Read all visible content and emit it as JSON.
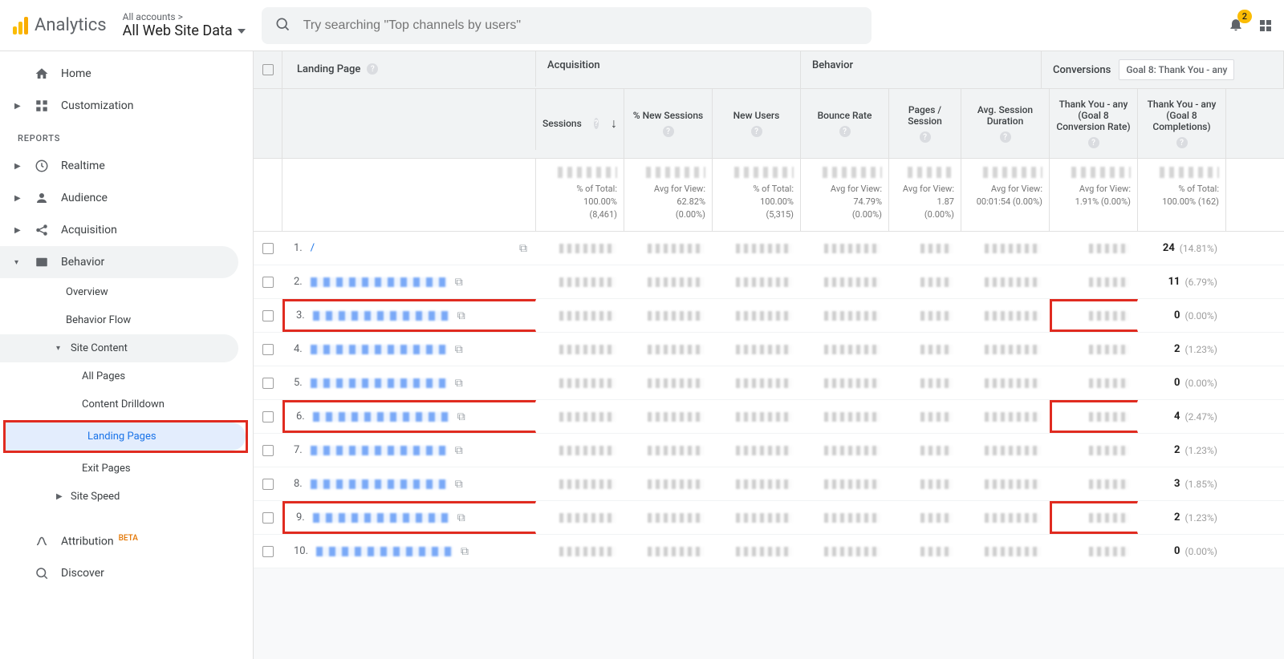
{
  "header": {
    "brand": "Analytics",
    "breadcrumb_label": "All accounts >",
    "view_name": "All Web Site Data",
    "search_placeholder": "Try searching \"Top channels by users\"",
    "notification_count": "2"
  },
  "sidebar": {
    "home": "Home",
    "customization": "Customization",
    "reports_header": "REPORTS",
    "realtime": "Realtime",
    "audience": "Audience",
    "acquisition": "Acquisition",
    "behavior": "Behavior",
    "behavior_children": {
      "overview": "Overview",
      "behavior_flow": "Behavior Flow",
      "site_content": "Site Content",
      "all_pages": "All Pages",
      "content_drilldown": "Content Drilldown",
      "landing_pages": "Landing Pages",
      "exit_pages": "Exit Pages",
      "site_speed": "Site Speed"
    },
    "attribution": "Attribution",
    "attribution_beta": "BETA",
    "discover": "Discover"
  },
  "table": {
    "dimension_label": "Landing Page",
    "groups": {
      "acquisition": "Acquisition",
      "behavior": "Behavior",
      "conversions": "Conversions"
    },
    "goal_selector": "Goal 8: Thank You - any",
    "columns": {
      "sessions": "Sessions",
      "pct_new_sessions": "% New Sessions",
      "new_users": "New Users",
      "bounce_rate": "Bounce Rate",
      "pages_per_session": "Pages / Session",
      "avg_session_duration": "Avg. Session Duration",
      "goal_rate": "Thank You - any (Goal 8 Conversion Rate)",
      "goal_completions": "Thank You - any (Goal 8 Completions)"
    },
    "summary": {
      "sessions": {
        "label": "% of Total:",
        "v1": "100.00%",
        "v2": "(8,461)"
      },
      "pct_new": {
        "label": "Avg for View:",
        "v1": "62.82%",
        "v2": "(0.00%)"
      },
      "new_users": {
        "label": "% of Total:",
        "v1": "100.00%",
        "v2": "(5,315)"
      },
      "bounce": {
        "label": "Avg for View:",
        "v1": "74.79%",
        "v2": "(0.00%)"
      },
      "pps": {
        "label": "Avg for View:",
        "v1": "1.87",
        "v2": "(0.00%)"
      },
      "asd": {
        "label": "Avg for View:",
        "v1": "00:01:54 (0.00%)",
        "v2": ""
      },
      "rate": {
        "label": "Avg for View:",
        "v1": "1.91% (0.00%)",
        "v2": ""
      },
      "comp": {
        "label": "% of Total:",
        "v1": "100.00% (162)",
        "v2": ""
      }
    },
    "rows": [
      {
        "n": "1.",
        "path": "/",
        "completions": "24",
        "pct": "(14.81%)",
        "hl": false
      },
      {
        "n": "2.",
        "path": "",
        "completions": "11",
        "pct": "(6.79%)",
        "hl": false
      },
      {
        "n": "3.",
        "path": "",
        "completions": "0",
        "pct": "(0.00%)",
        "hl": true
      },
      {
        "n": "4.",
        "path": "",
        "completions": "2",
        "pct": "(1.23%)",
        "hl": false
      },
      {
        "n": "5.",
        "path": "",
        "completions": "0",
        "pct": "(0.00%)",
        "hl": false
      },
      {
        "n": "6.",
        "path": "",
        "completions": "4",
        "pct": "(2.47%)",
        "hl": true
      },
      {
        "n": "7.",
        "path": "",
        "completions": "2",
        "pct": "(1.23%)",
        "hl": false
      },
      {
        "n": "8.",
        "path": "",
        "completions": "3",
        "pct": "(1.85%)",
        "hl": false
      },
      {
        "n": "9.",
        "path": "",
        "completions": "2",
        "pct": "(1.23%)",
        "hl": true
      },
      {
        "n": "10.",
        "path": "",
        "completions": "0",
        "pct": "(0.00%)",
        "hl": false
      }
    ]
  }
}
